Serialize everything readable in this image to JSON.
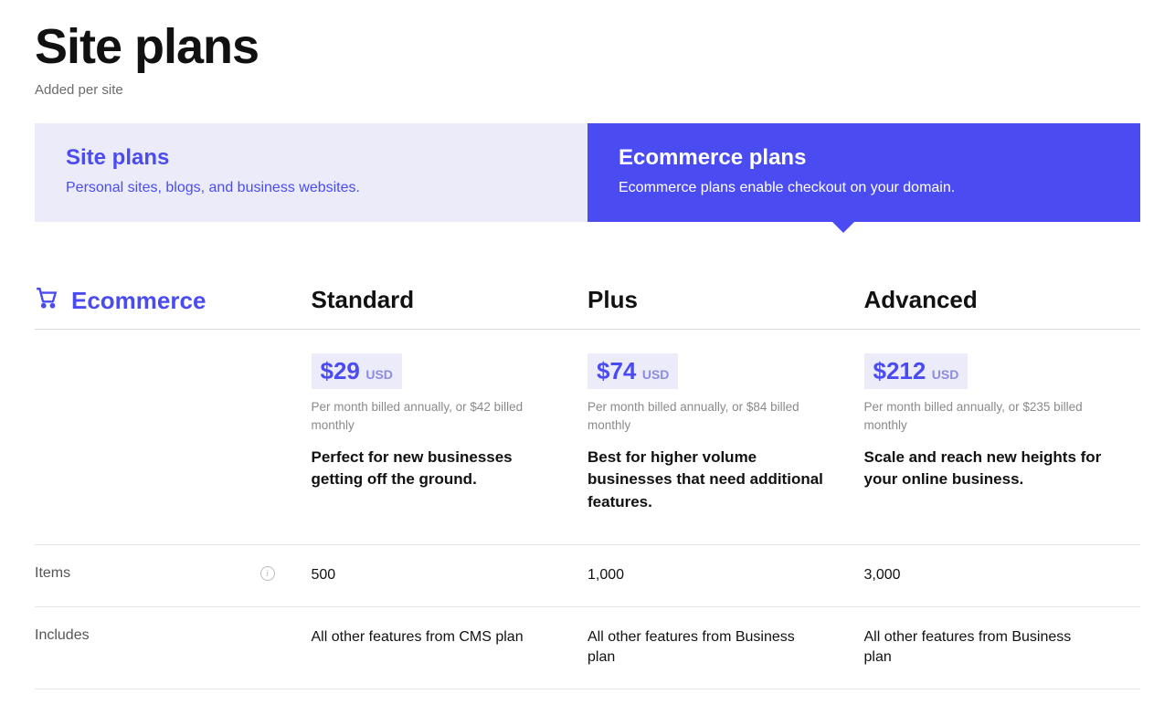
{
  "header": {
    "title": "Site plans",
    "subtitle": "Added per site"
  },
  "tabs": {
    "site": {
      "title": "Site plans",
      "desc": "Personal sites, blogs, and business websites."
    },
    "ecommerce": {
      "title": "Ecommerce plans",
      "desc": "Ecommerce plans enable checkout on your domain."
    }
  },
  "table": {
    "section_label": "Ecommerce",
    "currency": "USD",
    "plans": [
      {
        "name": "Standard",
        "price": "$29",
        "note": "Per month billed annually, or $42 billed monthly",
        "desc": "Perfect for new businesses getting off the ground."
      },
      {
        "name": "Plus",
        "price": "$74",
        "note": "Per month billed annually, or $84 billed monthly",
        "desc": "Best for higher volume businesses that need additional features."
      },
      {
        "name": "Advanced",
        "price": "$212",
        "note": "Per month billed annually, or $235 billed monthly",
        "desc": "Scale and reach new heights for your online business."
      }
    ],
    "rows": [
      {
        "label": "Items",
        "info": true,
        "values": [
          "500",
          "1,000",
          "3,000"
        ]
      },
      {
        "label": "Includes",
        "info": false,
        "values": [
          "All other features from CMS plan",
          "All other features from Business plan",
          "All other features from Business plan"
        ]
      }
    ]
  }
}
